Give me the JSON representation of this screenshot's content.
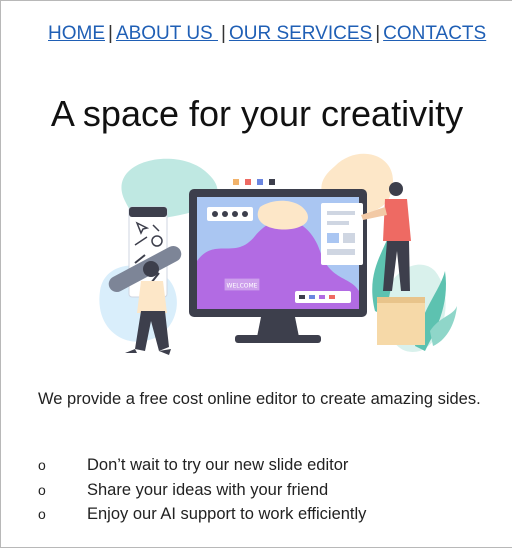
{
  "nav": {
    "items": [
      {
        "label": "HOME"
      },
      {
        "label": "ABOUT US "
      },
      {
        "label": "OUR SERVICES"
      },
      {
        "label": "CONTACTS"
      }
    ],
    "separator": "|"
  },
  "hero": {
    "title": "A space for your creativity",
    "illustration_icon": "designer-editor-illustration",
    "screen_label": "WELCOME"
  },
  "description": "We provide a free cost online editor to create amazing sides.",
  "bullets": {
    "marker": "o",
    "items": [
      "Don’t wait to try our new slide editor",
      "Share your ideas with your friend",
      "Enjoy our AI support to work efficiently"
    ]
  },
  "colors": {
    "link": "#1f5fb5",
    "monitor": "#3d3f4c",
    "screen_purple": "#b26be3",
    "screen_blue": "#aac6f2",
    "mint": "#bfe8e2",
    "teal": "#5dc2b0",
    "accent_coral": "#ee6a63"
  }
}
